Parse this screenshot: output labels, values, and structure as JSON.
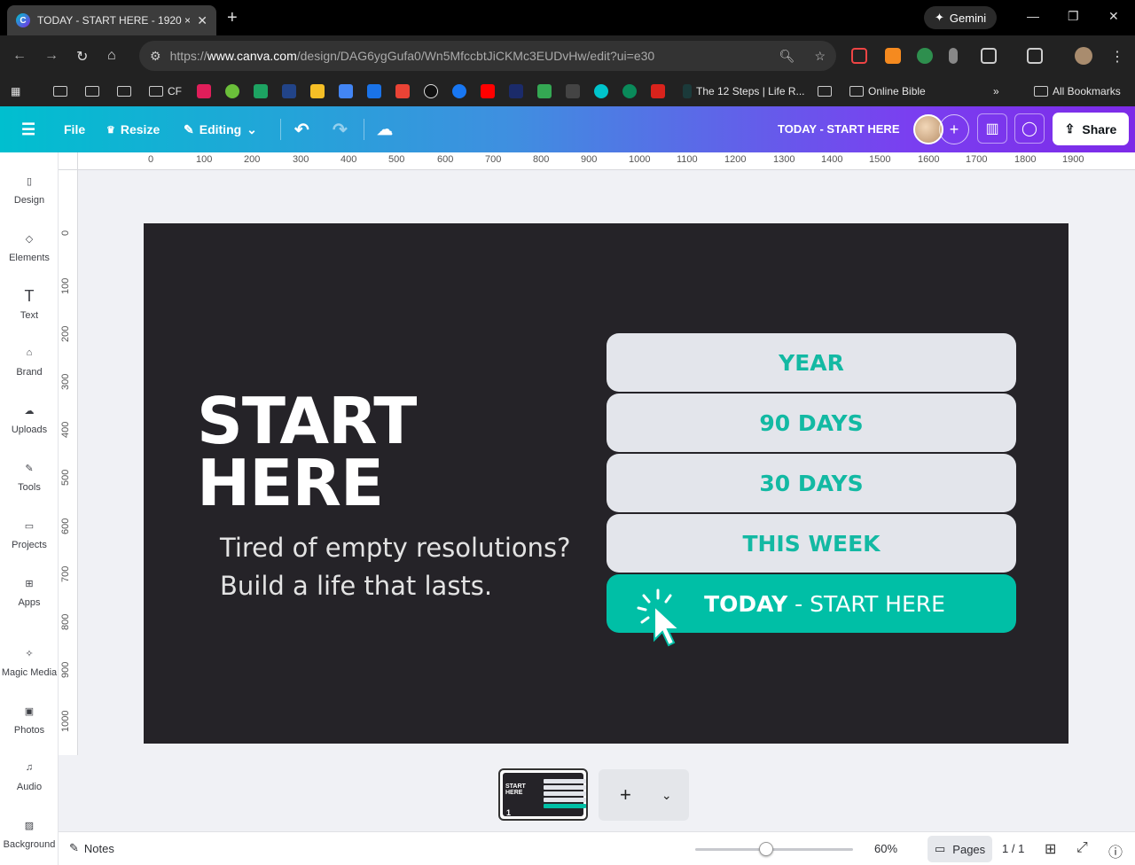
{
  "browser": {
    "tab_title": "TODAY - START HERE - 1920 ×",
    "gemini_label": "Gemini",
    "url_prefix": "https://",
    "url_host": "www.canva.com",
    "url_path": "/design/DAG6ygGufa0/Wn5MfccbtJiCKMc3EUDvHw/edit?ui=e30",
    "bookmarks": {
      "cf_label": "CF",
      "twelve_steps": "The 12 Steps | Life R...",
      "online_bible": "Online Bible",
      "all_bookmarks": "All Bookmarks"
    }
  },
  "canva_header": {
    "file": "File",
    "resize": "Resize",
    "editing": "Editing",
    "doc_title": "TODAY - START HERE",
    "share": "Share"
  },
  "sidebar": {
    "items": [
      {
        "label": "Design"
      },
      {
        "label": "Elements"
      },
      {
        "label": "Text"
      },
      {
        "label": "Brand"
      },
      {
        "label": "Uploads"
      },
      {
        "label": "Tools"
      },
      {
        "label": "Projects"
      },
      {
        "label": "Apps"
      },
      {
        "label": "Magic Media"
      },
      {
        "label": "Photos"
      },
      {
        "label": "Audio"
      },
      {
        "label": "Background"
      }
    ]
  },
  "ruler": {
    "top": [
      "0",
      "100",
      "200",
      "300",
      "400",
      "500",
      "600",
      "700",
      "800",
      "900",
      "1000",
      "1100",
      "1200",
      "1300",
      "1400",
      "1500",
      "1600",
      "1700",
      "1800",
      "1900"
    ],
    "left": [
      "0",
      "100",
      "200",
      "300",
      "400",
      "500",
      "600",
      "700",
      "800",
      "900",
      "1000"
    ]
  },
  "design": {
    "headline_line1": "START",
    "headline_line2": "HERE",
    "tagline_line1": "Tired of empty resolutions?",
    "tagline_line2": "Build a life that lasts.",
    "buttons": [
      "YEAR",
      "90 DAYS",
      "30 DAYS",
      "THIS WEEK"
    ],
    "today_bold": "TODAY",
    "today_rest": " - START HERE",
    "colors": {
      "background": "#252328",
      "accent": "#00bfa6",
      "button": "#e3e5eb"
    }
  },
  "footer": {
    "notes": "Notes",
    "zoom": "60%",
    "pages": "Pages",
    "page_count": "1 / 1",
    "thumb_number": "1"
  }
}
